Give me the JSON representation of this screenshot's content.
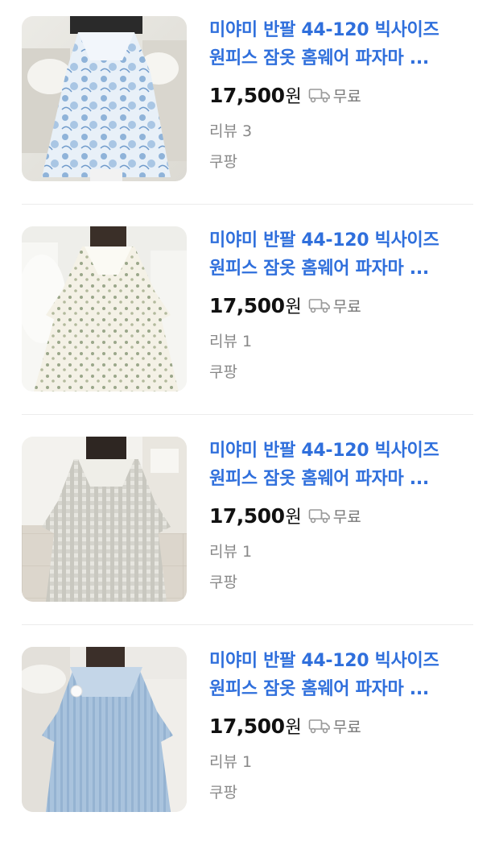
{
  "products": [
    {
      "title_line1": "미야미 반팔 44-120 빅사이즈",
      "title_line2": "원피스 잠옷 홈웨어 파자마 ...",
      "price": "17,500",
      "currency": "원",
      "shipping": "무료",
      "review": "리뷰 3",
      "seller": "쿠팡",
      "image_desc": "blue-floral-nightgown"
    },
    {
      "title_line1": "미야미 반팔 44-120 빅사이즈",
      "title_line2": "원피스 잠옷 홈웨어 파자마 ...",
      "price": "17,500",
      "currency": "원",
      "shipping": "무료",
      "review": "리뷰 1",
      "seller": "쿠팡",
      "image_desc": "cream-pattern-nightgown"
    },
    {
      "title_line1": "미야미 반팔 44-120 빅사이즈",
      "title_line2": "원피스 잠옷 홈웨어 파자마 ...",
      "price": "17,500",
      "currency": "원",
      "shipping": "무료",
      "review": "리뷰 1",
      "seller": "쿠팡",
      "image_desc": "gray-check-nightgown"
    },
    {
      "title_line1": "미야미 반팔 44-120 빅사이즈",
      "title_line2": "원피스 잠옷 홈웨어 파자마 ...",
      "price": "17,500",
      "currency": "원",
      "shipping": "무료",
      "review": "리뷰 1",
      "seller": "쿠팡",
      "image_desc": "light-blue-nightgown"
    }
  ],
  "colors": {
    "title": "#2f6fdc",
    "price": "#111111",
    "muted": "#888888",
    "divider": "#ececec"
  },
  "icons": {
    "shipping": "truck-icon"
  }
}
